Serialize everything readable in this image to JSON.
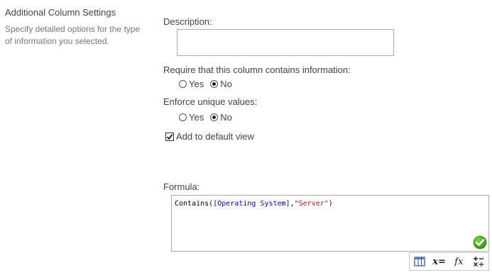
{
  "section": {
    "title": "Additional Column Settings",
    "description": "Specify detailed options for the type of information you selected."
  },
  "description_field": {
    "label": "Description:",
    "value": ""
  },
  "require_info": {
    "label": "Require that this column contains information:",
    "options": [
      "Yes",
      "No"
    ],
    "selected": "No"
  },
  "unique_values": {
    "label": "Enforce unique values:",
    "options": [
      "Yes",
      "No"
    ],
    "selected": "No"
  },
  "default_view": {
    "label": "Add to default view",
    "checked": true
  },
  "formula": {
    "label": "Formula:",
    "func": "Contains",
    "open": "(",
    "field": "[Operating System]",
    "sep": ",",
    "str": "\"Server\"",
    "close": ")",
    "status_icon": "valid-check-icon"
  },
  "toolbar": {
    "x_label": "x=",
    "fx_label": "fx",
    "icons": [
      "column-table-icon",
      "variable-icon",
      "function-icon",
      "operators-icon"
    ]
  },
  "colors": {
    "field_color": "#0000cc",
    "string_color": "#a31515",
    "ok_green": "#3a9a1a"
  }
}
